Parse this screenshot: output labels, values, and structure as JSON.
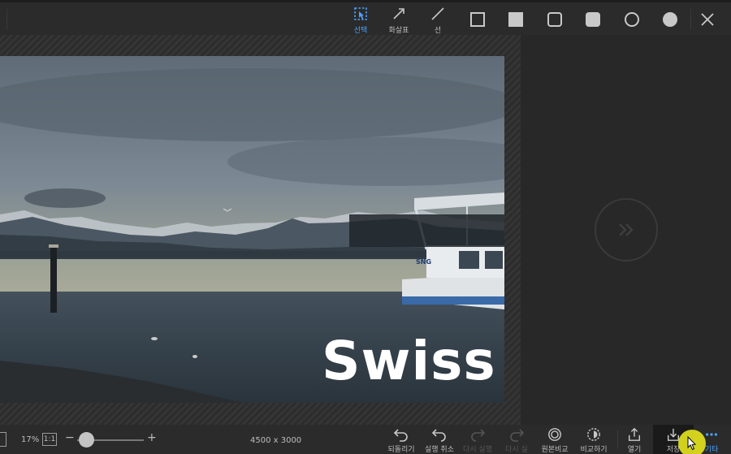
{
  "toolbar": {
    "tools": [
      {
        "id": "select",
        "label": "선택",
        "active": true
      },
      {
        "id": "arrow",
        "label": "화살표",
        "active": false
      },
      {
        "id": "line",
        "label": "선",
        "active": false
      }
    ],
    "shapes": [
      "square-outline-icon",
      "square-filled-icon",
      "rounded-square-outline-icon",
      "rounded-square-filled-icon",
      "circle-outline-icon",
      "circle-filled-icon"
    ]
  },
  "photo": {
    "watermark_text": "Swiss",
    "boat_label": "SNG"
  },
  "status": {
    "zoom_percent": "17%",
    "one_to_one": "1:1",
    "zoom_slider_value": 0.1,
    "dimensions": "4500 x 3000"
  },
  "actions": [
    {
      "id": "revert",
      "label": "되돌리기",
      "enabled": true
    },
    {
      "id": "undo",
      "label": "실행 취소",
      "enabled": true
    },
    {
      "id": "redo",
      "label": "다시 실행",
      "enabled": false
    },
    {
      "id": "redo2",
      "label": "다시 실",
      "enabled": false
    },
    {
      "id": "compare-original",
      "label": "원본비교",
      "enabled": true
    },
    {
      "id": "compare",
      "label": "비교하기",
      "enabled": true
    },
    {
      "id": "open",
      "label": "열기",
      "enabled": true
    },
    {
      "id": "save",
      "label": "저장",
      "enabled": true
    },
    {
      "id": "more",
      "label": "기타",
      "enabled": true
    }
  ],
  "colors": {
    "accent": "#4aa3ff",
    "cursor_highlight": "#e6e61e"
  }
}
